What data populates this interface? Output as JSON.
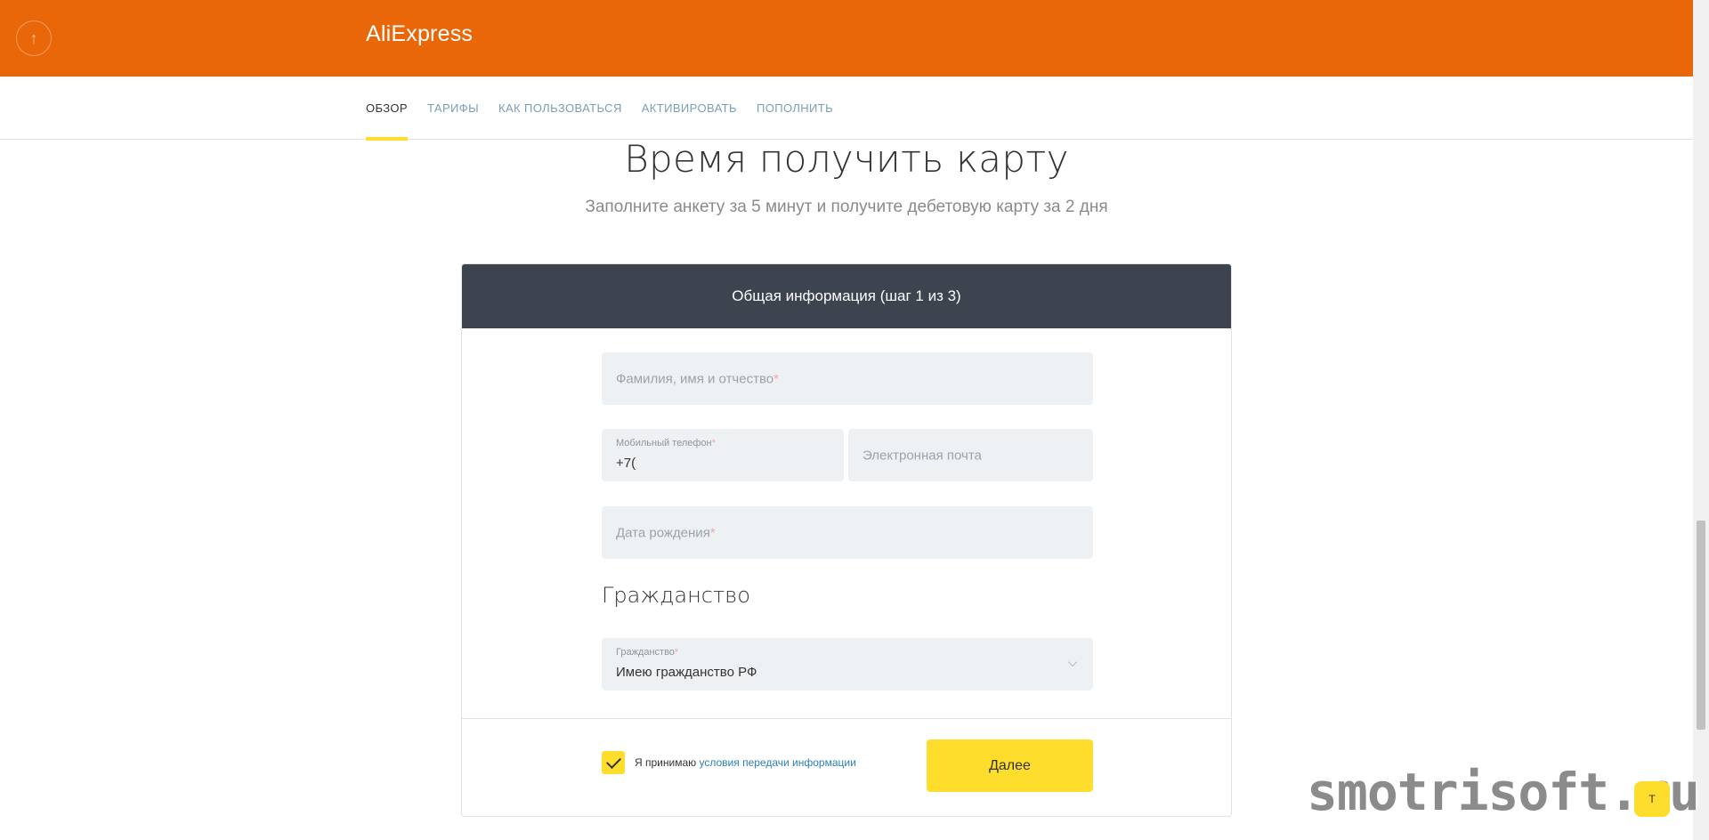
{
  "header": {
    "brand": "AliExpress",
    "back_icon": "arrow-up-icon",
    "color": "#ea6709"
  },
  "tabs": [
    {
      "label": "ОБЗОР",
      "active": true
    },
    {
      "label": "ТАРИФЫ",
      "active": false
    },
    {
      "label": "КАК ПОЛЬЗОВАТЬСЯ",
      "active": false
    },
    {
      "label": "АКТИВИРОВАТЬ",
      "active": false
    },
    {
      "label": "ПОПОЛНИТЬ",
      "active": false
    }
  ],
  "hero": {
    "title": "Время получить карту",
    "subtitle": "Заполните анкету за 5 минут и получите дебетовую карту за 2 дня"
  },
  "form": {
    "header": "Общая информация (шаг 1 из 3)",
    "fio_placeholder": "Фамилия, имя и отчество",
    "phone_label": "Мобильный телефон",
    "phone_value": "+7(",
    "email_placeholder": "Электронная почта",
    "birth_placeholder": "Дата рождения",
    "required_mark": "*",
    "citizenship_section": "Гражданство",
    "citizenship_label": "Гражданство",
    "citizenship_value": "Имею гражданство РФ",
    "consent_text": "Я принимаю",
    "consent_link": "условия передачи информации",
    "consent_checked": true,
    "next_button": "Далее"
  },
  "watermark": {
    "text": "smotrisoft.ru",
    "badge": "T"
  },
  "colors": {
    "accent": "#ffdd2d",
    "card_header": "#3d4450",
    "link": "#2d7fb8",
    "tab_inactive": "#7a9fb5"
  }
}
